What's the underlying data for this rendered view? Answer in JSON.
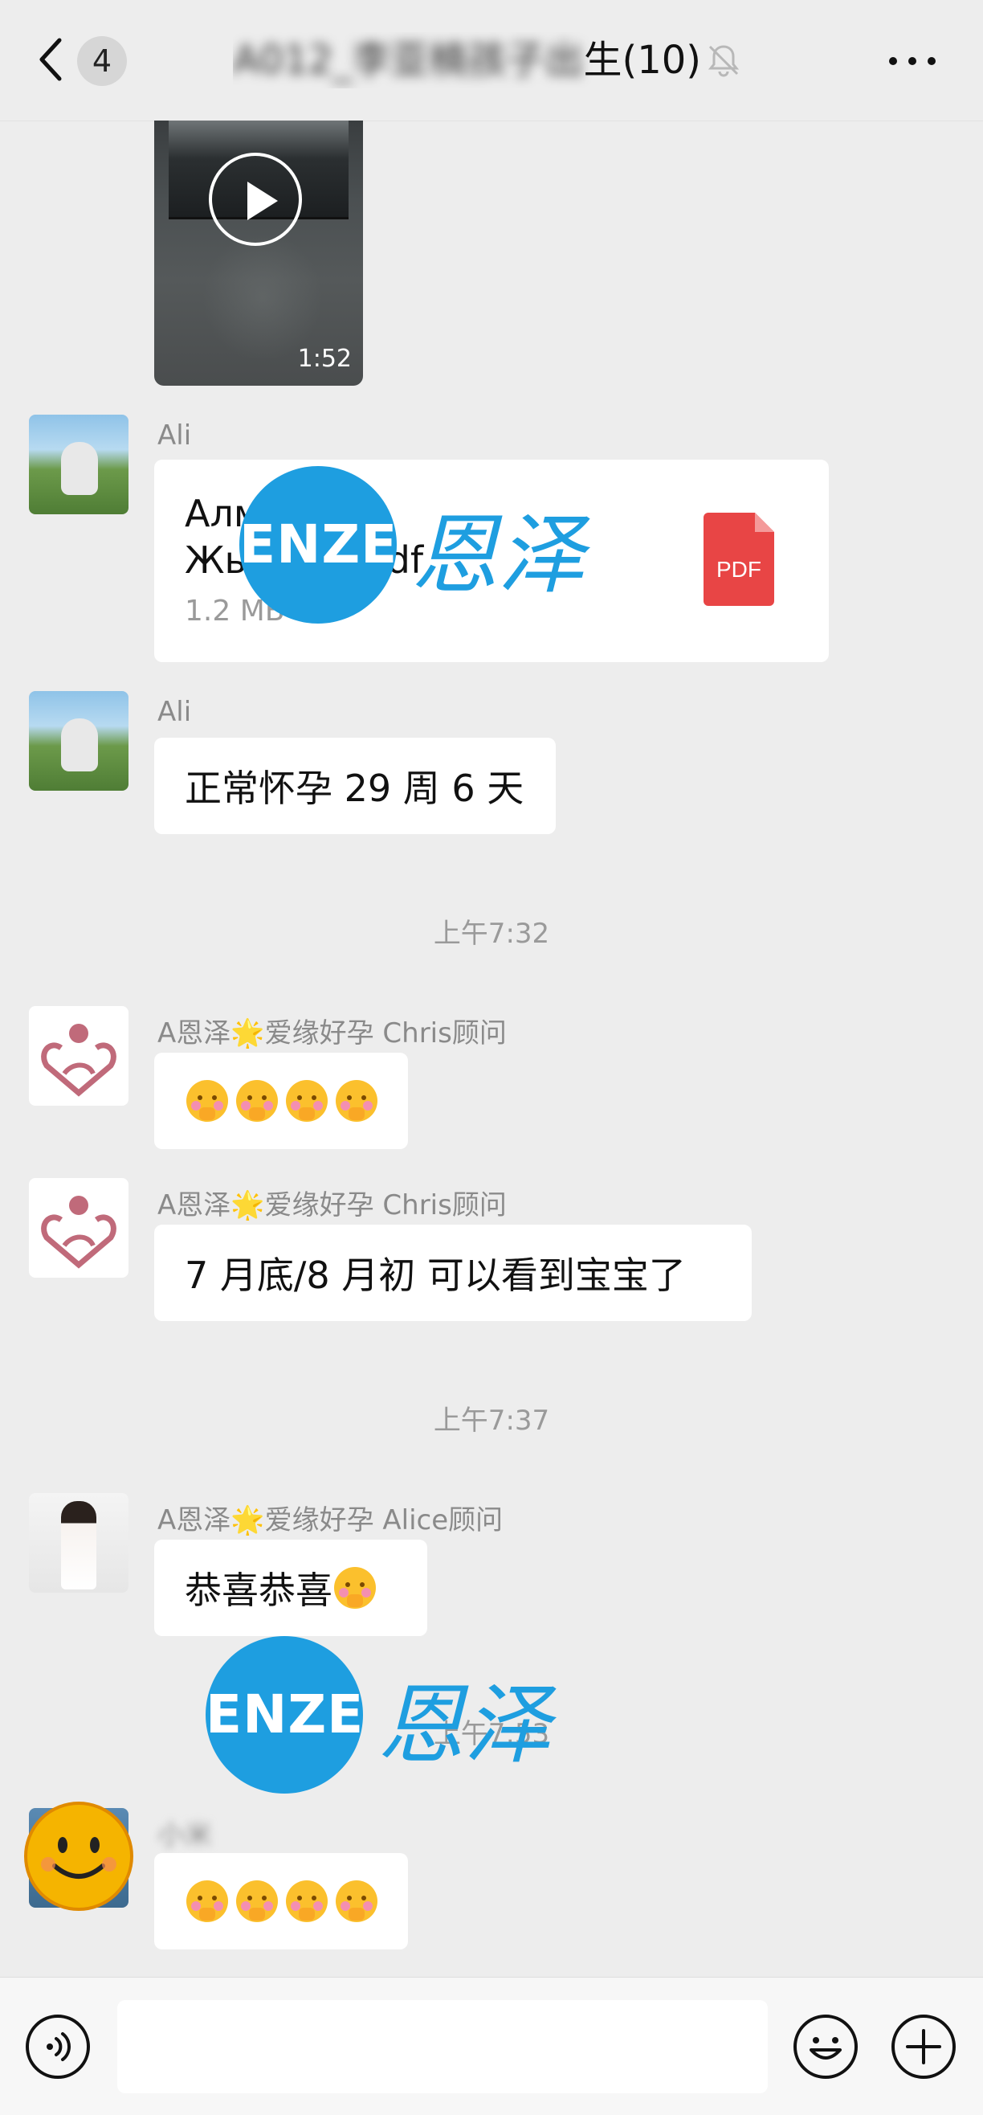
{
  "header": {
    "unread_count": "4",
    "title_blurred": "A012_李亚楠孩子出",
    "title_visible": "生(10)"
  },
  "video": {
    "duration": "1:52"
  },
  "messages": [
    {
      "sender": "Ali",
      "file": {
        "name_line1": "Алмазова",
        "name_line2": "Жылдыз.pdf",
        "size": "1.2 MB",
        "type_label": "PDF"
      }
    },
    {
      "sender": "Ali",
      "text": "正常怀孕 29 周 6 天"
    },
    {
      "timestamp": "上午7:32"
    },
    {
      "sender": "A恩泽🌟爱缘好孕 Chris顾问",
      "emoji_count": 4
    },
    {
      "sender": "A恩泽🌟爱缘好孕 Chris顾问",
      "text": "7 月底/8 月初 可以看到宝宝了"
    },
    {
      "timestamp": "上午7:37"
    },
    {
      "sender": "A恩泽🌟爱缘好孕 Alice顾问",
      "text": "恭喜恭喜"
    },
    {
      "timestamp": "上午7:53"
    },
    {
      "sender": "小米",
      "emoji_count": 4
    }
  ],
  "watermark": {
    "logo_text": "ENZE",
    "cn_text": "恩泽"
  },
  "icons": {
    "back": "chevron-left-icon",
    "mute": "bell-off-icon",
    "more": "more-dots-icon",
    "voice": "voice-icon",
    "emoji": "smiley-icon",
    "plus": "plus-icon",
    "pdf": "pdf-icon"
  },
  "colors": {
    "background": "#ededed",
    "bubble": "#ffffff",
    "watermark": "#1e9ee0",
    "pdf": "#e84545"
  }
}
